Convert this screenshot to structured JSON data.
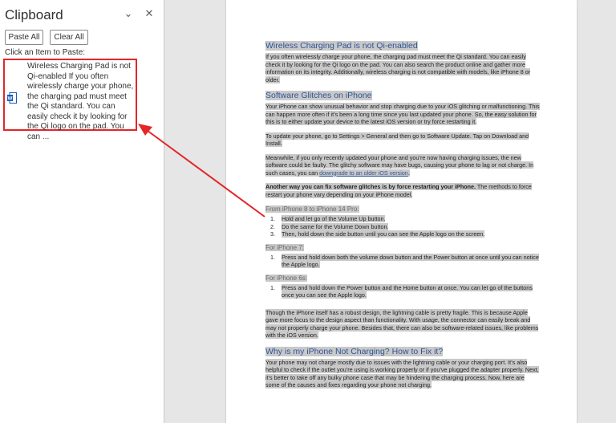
{
  "pane": {
    "title": "Clipboard",
    "paste_all": "Paste All",
    "clear_all": "Clear All",
    "hint": "Click an Item to Paste:",
    "item_text": "Wireless Charging Pad is not Qi-enabled If you often wirelessly charge your phone, the charging pad must meet the Qi standard. You can easily check it by looking for the Qi logo on the pad. You can ..."
  },
  "doc": {
    "h_wireless": "Wireless Charging Pad is not Qi-enabled",
    "p_wireless": "If you often wirelessly charge your phone, the charging pad must meet the Qi standard. You can easily check it by looking for the Qi logo on the pad. You can also search the product online and gather more information on its integrity. Additionally, wireless charging is not compatible with models, like iPhone 8 or older.",
    "h_glitches": "Software Glitches on iPhone",
    "p_glitches": "Your iPhone can show unusual behavior and stop charging due to your iOS glitching or malfunctioning. This can happen more often if it’s been a long time since you last updated your phone. So, the easy solution for this is to either update your device to the latest iOS version or try force restarting it.",
    "p_update": "To update your phone, go to Settings > General and then go to Software Update. Tap on Download and Install.",
    "p_meanwhile": "Meanwhile, if you only recently updated your phone and you’re now having charging issues, the new software could be faulty. The glitchy software may have bugs, causing your phone to lag or not charge. In such cases, you can",
    "link_downgrade": "downgrade to an older iOS version",
    "p_another_bold": "Another way you can fix software glitches is by force restarting your iPhone.",
    "p_another_rest": "The methods to force restart your phone vary depending on your iPhone model.",
    "h_8to14": "From iPhone 8 to iPhone 14 Pro:",
    "steps_8to14": [
      "Hold and let go of the Volume Up button.",
      "Do the same for the Volume Down button.",
      "Then, hold down the side button until you can see the Apple logo on the screen."
    ],
    "h_7": "For iPhone 7:",
    "steps_7": [
      "Press and hold down both the volume down button and the Power button at once until you can notice the Apple logo."
    ],
    "h_6s": "For iPhone 6s:",
    "steps_6s": [
      "Press and hold down the Power button and the Home button at once. You can let go of the buttons once you can see the Apple logo."
    ],
    "p_though": "Though the iPhone itself has a robust design, the lightning cable is pretty fragile. This is because Apple gave more focus to the design aspect than functionality. With usage, the connector can easily break and may not properly charge your phone. Besides that, there can also be software-related issues, like problems with the iOS version.",
    "h_why": "Why is my iPhone Not Charging? How to Fix it?",
    "p_why": "Your phone may not charge mostly due to issues with the lightning cable or your charging port. It’s also helpful to check if the outlet you’re using is working properly or if you’ve plugged the adapter properly. Next, it’s better to take off any bulky phone case that may be hindering the charging process. Now, here are some of the causes and fixes regarding your phone not charging."
  },
  "colors": {
    "highlight_box": "#e3262a",
    "arrow": "#e3262a",
    "heading": "#2f5597",
    "selection": "#c9c9c9"
  }
}
